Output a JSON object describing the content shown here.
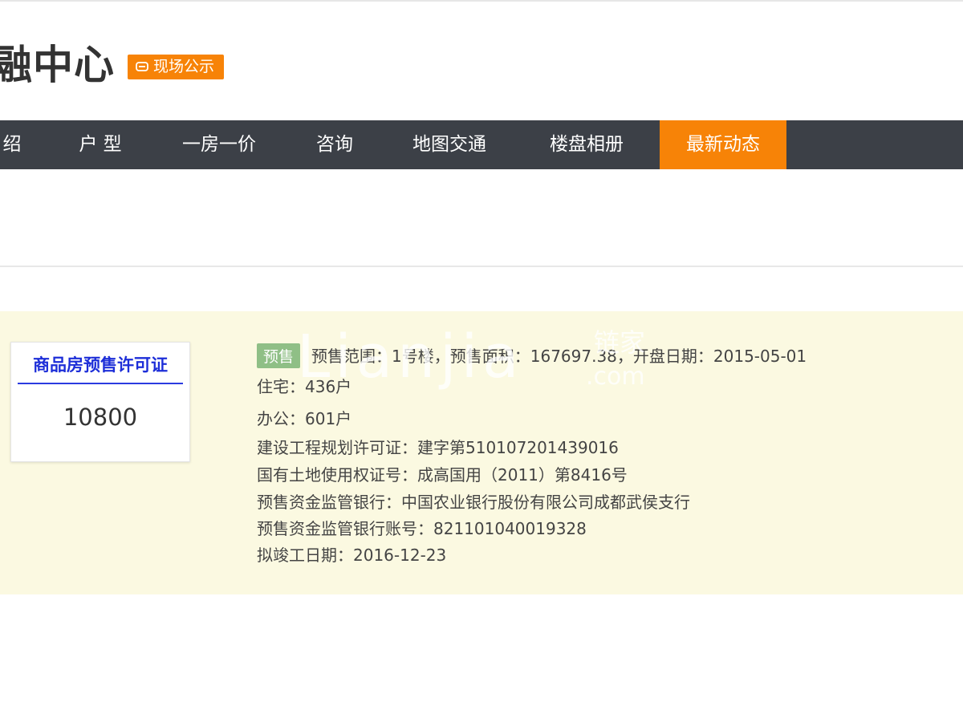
{
  "header": {
    "title": "融中心",
    "live_badge": "现场公示"
  },
  "nav": {
    "items": [
      {
        "label": "绍"
      },
      {
        "label": "户 型"
      },
      {
        "label": "一房一价"
      },
      {
        "label": "咨询"
      },
      {
        "label": "地图交通"
      },
      {
        "label": "楼盘相册"
      },
      {
        "label": "最新动态",
        "active": true
      }
    ]
  },
  "permit": {
    "title": "商品房预售许可证",
    "number": "10800"
  },
  "details": {
    "tag": "预售",
    "line1": "预售范围：1号楼，预售面积：167697.38，开盘日期：2015-05-01",
    "residential": "住宅：436户",
    "office": "办公：601户",
    "planning_permit": "建设工程规划许可证：建字第510107201439016",
    "land_permit": "国有土地使用权证号：成高国用（2011）第8416号",
    "supervising_bank": "预售资金监管银行：中国农业银行股份有限公司成都武侯支行",
    "bank_account": "预售资金监管银行账号：821101040019328",
    "completion_date": "拟竣工日期：2016-12-23"
  },
  "watermark": {
    "brand": "Lianjia",
    "cn": "链家",
    "domain": ".com"
  },
  "colors": {
    "accent": "#f78307",
    "nav_bg": "#3c4047",
    "panel_bg": "#fbf9e1",
    "permit_blue": "#1d2ed8",
    "tag_green": "#8fbf86"
  }
}
